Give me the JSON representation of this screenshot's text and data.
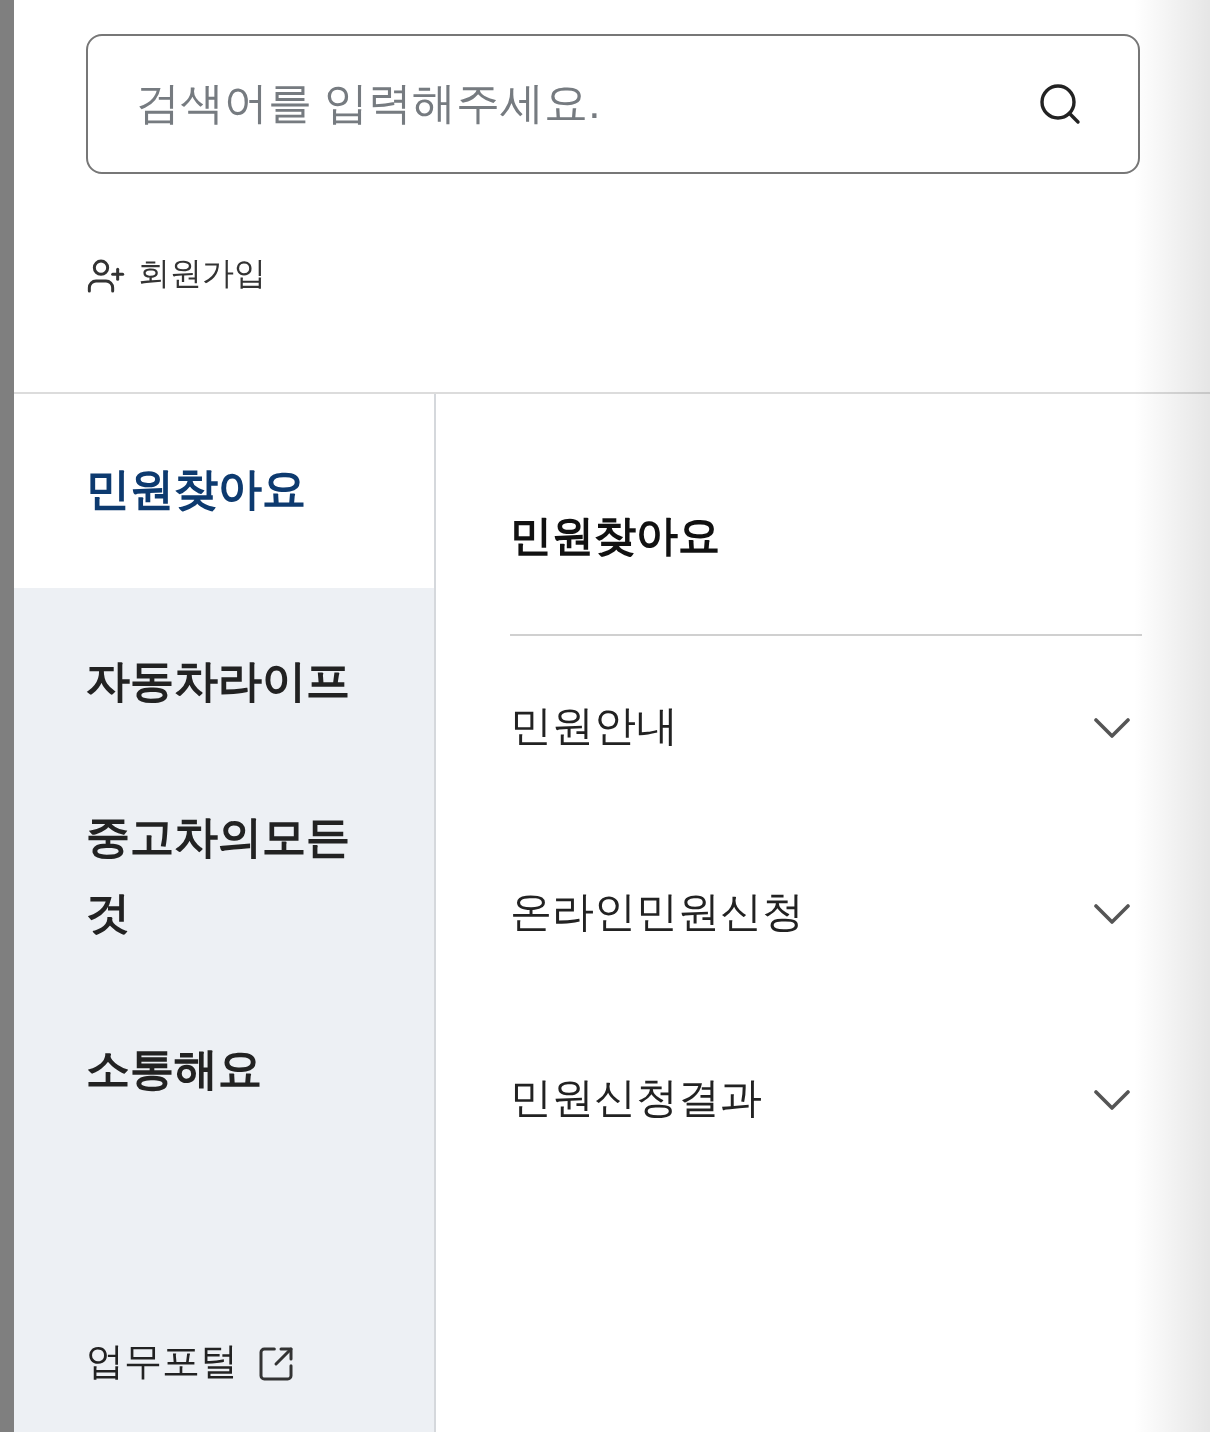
{
  "search": {
    "placeholder": "검색어를 입력해주세요."
  },
  "signup_link": {
    "label": "회원가입"
  },
  "categories": [
    {
      "label": "민원찾아요",
      "selected": true
    },
    {
      "label": "자동차라이프",
      "selected": false
    },
    {
      "label": "중고차의모든 것",
      "selected": false
    },
    {
      "label": "소통해요",
      "selected": false
    }
  ],
  "portal_link": {
    "label": "업무포털"
  },
  "submenu": {
    "title": "민원찾아요",
    "items": [
      {
        "label": "민원안내",
        "expanded": false
      },
      {
        "label": "온라인민원신청",
        "expanded": false
      },
      {
        "label": "민원신청결과",
        "expanded": false
      }
    ]
  }
}
